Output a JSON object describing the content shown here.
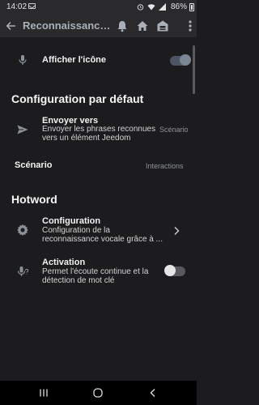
{
  "status_bar": {
    "time": "14:02",
    "battery": "86%",
    "icons": [
      "mail-icon",
      "alarm-icon",
      "wifi-icon",
      "signal-icon"
    ]
  },
  "app_bar": {
    "title": "Reconnaissance v...",
    "back_icon": "arrow-left-icon",
    "action_icons": [
      "bell-icon",
      "home-icon",
      "building-icon"
    ],
    "more_icon": "more-vertical-icon"
  },
  "settings": {
    "show_icon": {
      "label": "Afficher l'icône",
      "icon": "microphone-icon",
      "toggle": "on"
    },
    "default_section": {
      "title": "Configuration par défaut"
    },
    "send_to": {
      "title": "Envoyer vers",
      "subtitle_line1": "Envoyer les phrases reconnues",
      "subtitle_line2": "vers un élément Jeedom",
      "value": "Scénario",
      "icon": "send-icon"
    },
    "scenario": {
      "label": "Scénario",
      "value": "Interactions"
    },
    "hotword_section": {
      "title": "Hotword"
    },
    "configuration": {
      "title": "Configuration",
      "subtitle_line1": "Configuration de la",
      "subtitle_line2": "reconnaissance vocale grâce à ...",
      "icon": "gear-icon"
    },
    "activation": {
      "title": "Activation",
      "subtitle_line1": "Permet l'écoute continue et la",
      "subtitle_line2": "détection de mot clé",
      "icon": "microphone-question-icon",
      "toggle": "off"
    }
  },
  "nav_bar": {
    "items": [
      "recent-apps-icon",
      "home-circle-icon",
      "back-chevron-icon"
    ]
  },
  "colors": {
    "background": "#1c1c1e",
    "bar": "#2a2a2c",
    "title_muted": "#a9b0b8",
    "secondary": "#8d939a"
  }
}
